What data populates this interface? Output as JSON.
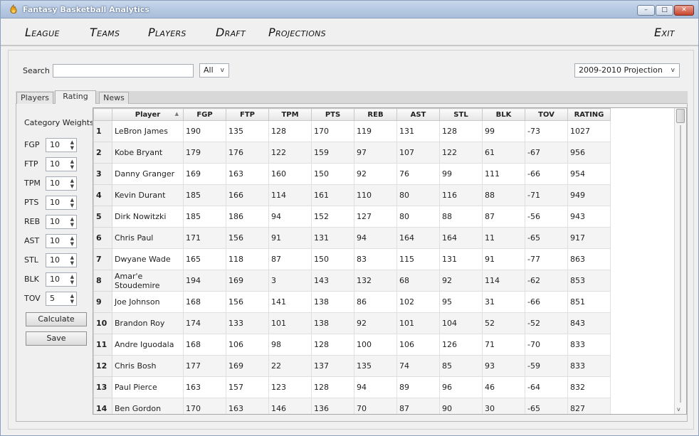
{
  "window": {
    "title": "Fantasy Basketball Analytics",
    "min_symbol": "–",
    "max_symbol": "□",
    "close_symbol": "✕"
  },
  "menu": {
    "league": "League",
    "teams": "Teams",
    "players": "Players",
    "draft": "Draft",
    "projections": "Projections",
    "exit": "Exit"
  },
  "search": {
    "label": "Search",
    "value": "",
    "filter": "All",
    "filter_arrow": "v"
  },
  "projection_select": {
    "value": "2009-2010 Projection",
    "arrow": "v"
  },
  "tabs": {
    "players": "Players",
    "rating": "Rating",
    "news": "News",
    "active": "Rating"
  },
  "weights": {
    "title": "Category Weights",
    "items": [
      {
        "label": "FGP",
        "value": "10"
      },
      {
        "label": "FTP",
        "value": "10"
      },
      {
        "label": "TPM",
        "value": "10"
      },
      {
        "label": "PTS",
        "value": "10"
      },
      {
        "label": "REB",
        "value": "10"
      },
      {
        "label": "AST",
        "value": "10"
      },
      {
        "label": "STL",
        "value": "10"
      },
      {
        "label": "BLK",
        "value": "10"
      },
      {
        "label": "TOV",
        "value": "5"
      }
    ],
    "calculate": "Calculate",
    "save": "Save"
  },
  "table": {
    "columns": [
      "Player",
      "FGP",
      "FTP",
      "TPM",
      "PTS",
      "REB",
      "AST",
      "STL",
      "BLK",
      "TOV",
      "RATING"
    ],
    "sort_indicator": "▲",
    "rows": [
      {
        "num": "1",
        "cells": [
          "LeBron James",
          "190",
          "135",
          "128",
          "170",
          "119",
          "131",
          "128",
          "99",
          "-73",
          "1027"
        ]
      },
      {
        "num": "2",
        "cells": [
          "Kobe Bryant",
          "179",
          "176",
          "122",
          "159",
          "97",
          "107",
          "122",
          "61",
          "-67",
          "956"
        ]
      },
      {
        "num": "3",
        "cells": [
          "Danny Granger",
          "169",
          "163",
          "160",
          "150",
          "92",
          "76",
          "99",
          "111",
          "-66",
          "954"
        ]
      },
      {
        "num": "4",
        "cells": [
          "Kevin Durant",
          "185",
          "166",
          "114",
          "161",
          "110",
          "80",
          "116",
          "88",
          "-71",
          "949"
        ]
      },
      {
        "num": "5",
        "cells": [
          "Dirk Nowitzki",
          "185",
          "186",
          "94",
          "152",
          "127",
          "80",
          "88",
          "87",
          "-56",
          "943"
        ]
      },
      {
        "num": "6",
        "cells": [
          "Chris Paul",
          "171",
          "156",
          "91",
          "131",
          "94",
          "164",
          "164",
          "11",
          "-65",
          "917"
        ]
      },
      {
        "num": "7",
        "cells": [
          "Dwyane Wade",
          "165",
          "118",
          "87",
          "150",
          "83",
          "115",
          "131",
          "91",
          "-77",
          "863"
        ]
      },
      {
        "num": "8",
        "cells": [
          "Amar'e Stoudemire",
          "194",
          "169",
          "3",
          "143",
          "132",
          "68",
          "92",
          "114",
          "-62",
          "853"
        ]
      },
      {
        "num": "9",
        "cells": [
          "Joe Johnson",
          "168",
          "156",
          "141",
          "138",
          "86",
          "102",
          "95",
          "31",
          "-66",
          "851"
        ]
      },
      {
        "num": "10",
        "cells": [
          "Brandon Roy",
          "174",
          "133",
          "101",
          "138",
          "92",
          "101",
          "104",
          "52",
          "-52",
          "843"
        ]
      },
      {
        "num": "11",
        "cells": [
          "Andre Iguodala",
          "168",
          "106",
          "98",
          "128",
          "100",
          "106",
          "126",
          "71",
          "-70",
          "833"
        ]
      },
      {
        "num": "12",
        "cells": [
          "Chris Bosh",
          "177",
          "169",
          "22",
          "137",
          "135",
          "74",
          "85",
          "93",
          "-59",
          "833"
        ]
      },
      {
        "num": "13",
        "cells": [
          "Paul Pierce",
          "163",
          "157",
          "123",
          "128",
          "94",
          "89",
          "96",
          "46",
          "-64",
          "832"
        ]
      },
      {
        "num": "14",
        "cells": [
          "Ben Gordon",
          "170",
          "163",
          "146",
          "136",
          "70",
          "87",
          "90",
          "30",
          "-65",
          "827"
        ]
      }
    ]
  }
}
